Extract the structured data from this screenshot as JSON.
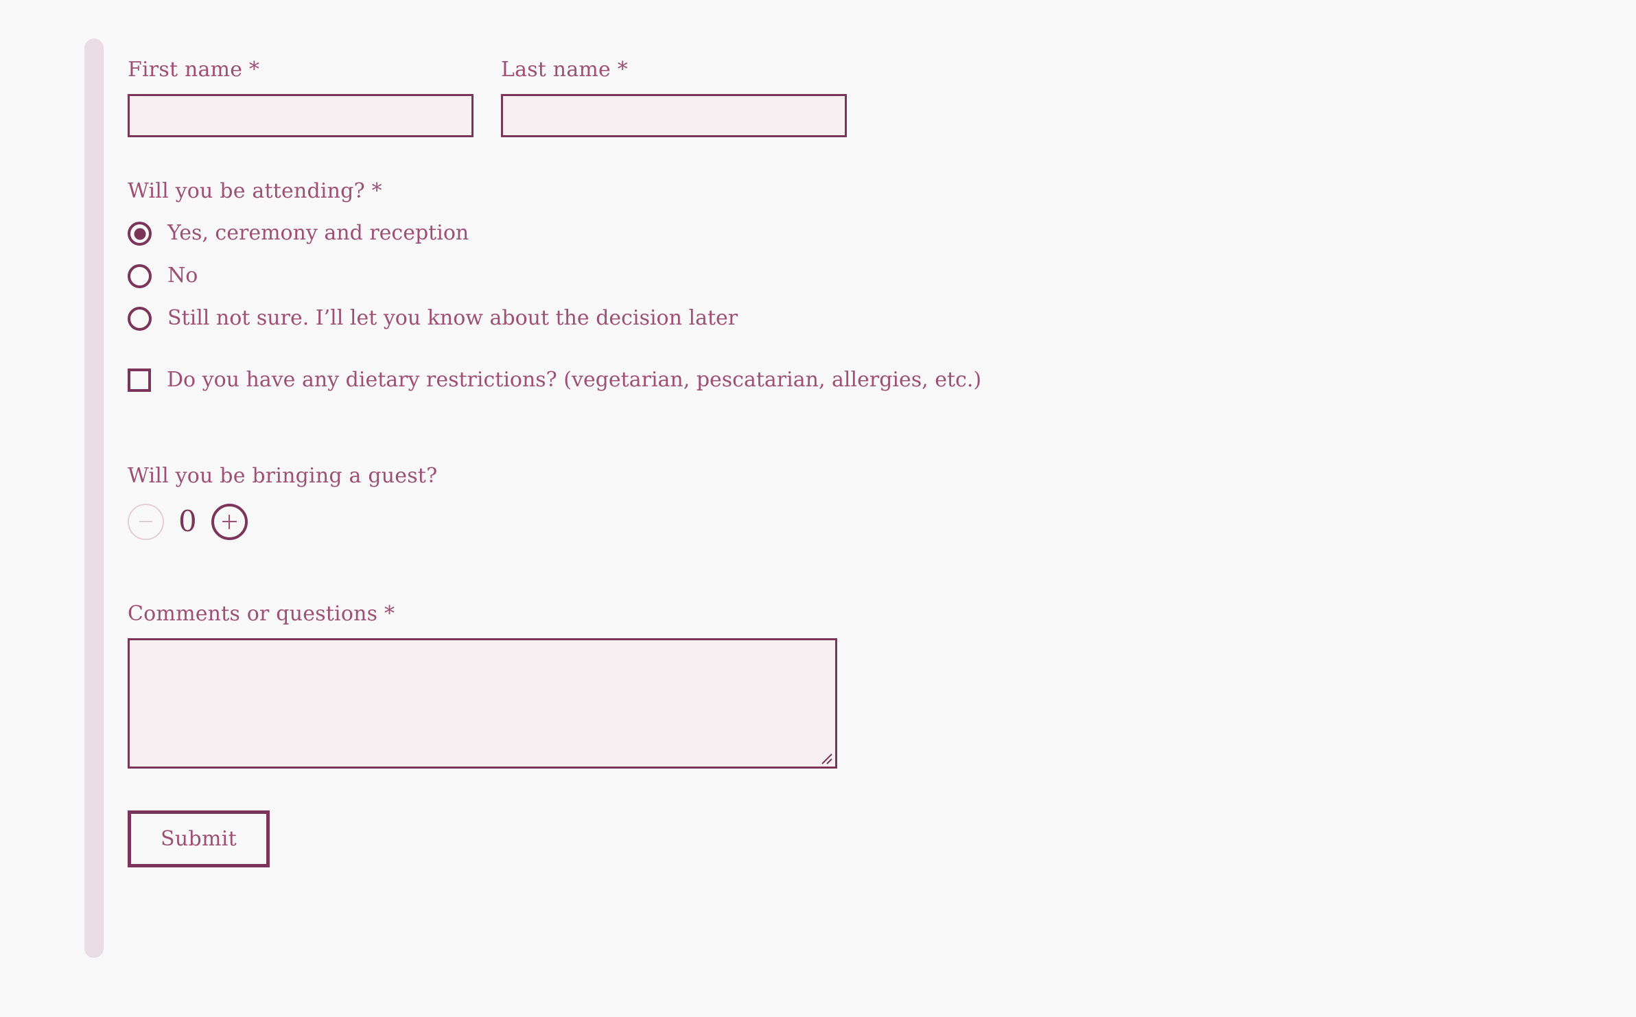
{
  "theme": {
    "page_background": "#f8f8f8",
    "accent_bar_color": "#e9dce4",
    "border_color": "#7b3558",
    "text_color": "#9d4f74",
    "input_fill": "#f7f0f3",
    "disabled_color": "#e3cdd8"
  },
  "form": {
    "first_name": {
      "label": "First name *",
      "value": "",
      "placeholder": ""
    },
    "last_name": {
      "label": "Last name *",
      "value": "",
      "placeholder": ""
    },
    "attending": {
      "label": "Will you be attending? *",
      "selected": "Yes, ceremony and reception",
      "options": [
        {
          "label": "Yes, ceremony and reception",
          "checked": true
        },
        {
          "label": "No",
          "checked": false
        },
        {
          "label": "Still not sure. I’ll let you know about the decision later",
          "checked": false
        }
      ]
    },
    "dietary": {
      "label": "Do you have any dietary restrictions? (vegetarian, pescatarian, allergies, etc.)",
      "checked": false
    },
    "guest": {
      "label": "Will you be bringing a guest?",
      "count": "0",
      "decrement_label": "−",
      "increment_label": "+",
      "decrement_enabled": false,
      "increment_enabled": true
    },
    "comments": {
      "label": "Comments or questions *",
      "value": "",
      "placeholder": ""
    },
    "submit": {
      "label": "Submit"
    }
  }
}
